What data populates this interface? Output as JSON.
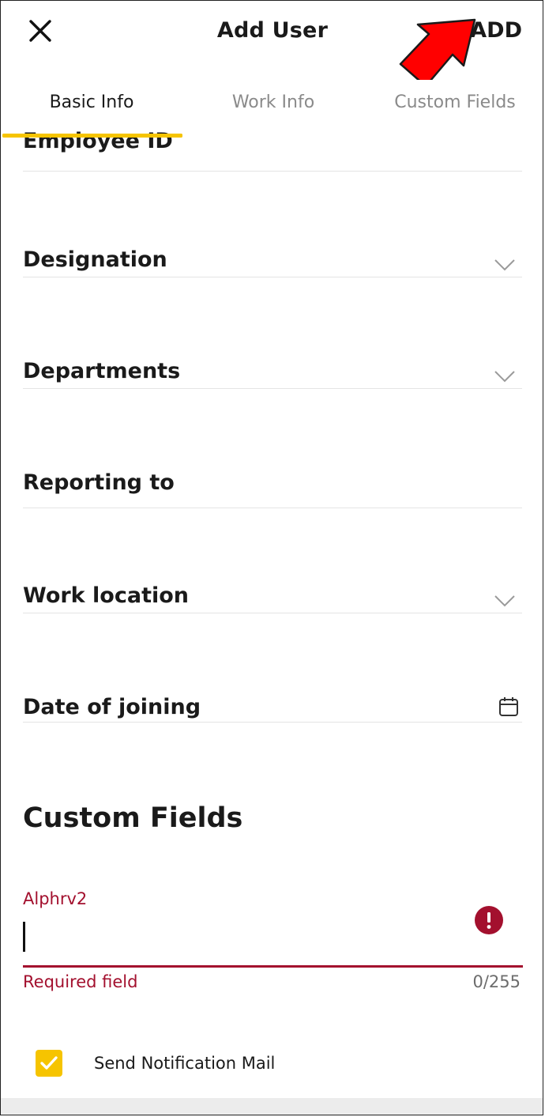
{
  "header": {
    "title": "Add User",
    "add_label": "ADD",
    "close_icon": "close-icon"
  },
  "tabs": [
    {
      "label": "Basic Info",
      "active": true
    },
    {
      "label": "Work Info",
      "active": false
    },
    {
      "label": "Custom Fields",
      "active": false
    }
  ],
  "fields": {
    "employee_id": "Employee ID",
    "designation": "Designation",
    "departments": "Departments",
    "reporting_to": "Reporting to",
    "work_location": "Work location",
    "date_of_joining": "Date of joining"
  },
  "custom_fields": {
    "section_title": "Custom Fields",
    "alphrv2": {
      "label": "Alphrv2",
      "value": "",
      "error": "Required field",
      "counter": "0/255"
    }
  },
  "notification": {
    "label": "Send Notification Mail",
    "checked": true
  },
  "colors": {
    "accent": "#f6c400",
    "error": "#a3102e",
    "annotation_arrow": "#ff0000"
  }
}
